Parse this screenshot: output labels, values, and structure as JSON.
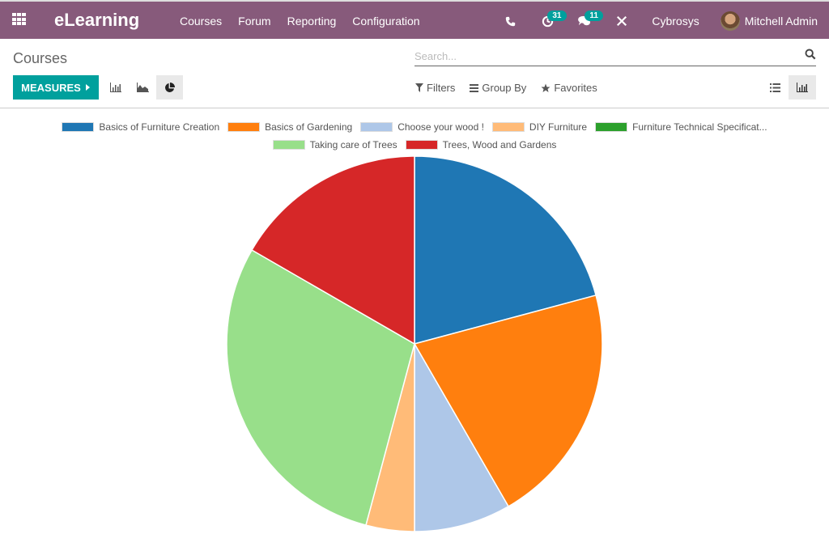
{
  "topbar": {
    "app_name": "eLearning",
    "menu": [
      "Courses",
      "Forum",
      "Reporting",
      "Configuration"
    ],
    "activity_count": "31",
    "messages_count": "11",
    "company": "Cybrosys",
    "user": "Mitchell Admin"
  },
  "control_panel": {
    "breadcrumb": "Courses",
    "search_placeholder": "Search...",
    "measures_label": "MEASURES",
    "filters_label": "Filters",
    "group_by_label": "Group By",
    "favorites_label": "Favorites",
    "active_chart_mode": "pie",
    "active_view": "graph"
  },
  "chart_data": {
    "type": "pie",
    "title": "",
    "legend_position": "top",
    "labels": [
      "Basics of Furniture Creation",
      "Basics of Gardening",
      "Choose your wood !",
      "DIY Furniture",
      "Furniture Technical Specificat...",
      "Taking care of Trees",
      "Trees, Wood and Gardens"
    ],
    "values": [
      5,
      5,
      2,
      1,
      0,
      7,
      4
    ],
    "colors": [
      "#1f77b4",
      "#ff7f0e",
      "#aec7e8",
      "#ffbb78",
      "#2ca02c",
      "#98df8a",
      "#d62728"
    ]
  }
}
